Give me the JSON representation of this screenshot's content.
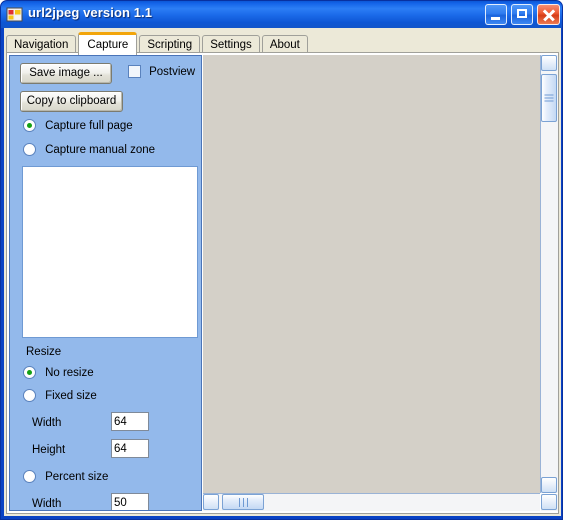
{
  "window": {
    "title": "url2jpeg version 1.1",
    "icon": "app-icon",
    "buttons": {
      "minimize": "minimize-icon",
      "maximize": "maximize-icon",
      "close": "close-icon"
    }
  },
  "tabs": [
    {
      "label": "Navigation",
      "selected": false
    },
    {
      "label": "Capture",
      "selected": true
    },
    {
      "label": "Scripting",
      "selected": false
    },
    {
      "label": "Settings",
      "selected": false
    },
    {
      "label": "About",
      "selected": false
    }
  ],
  "capture_panel": {
    "save_image_button": "Save image ...",
    "copy_clipboard_button": "Copy to clipboard",
    "postview": {
      "label": "Postview",
      "checked": false
    },
    "capture_mode": [
      {
        "label": "Capture full page",
        "selected": true
      },
      {
        "label": "Capture manual zone",
        "selected": false
      }
    ],
    "resize": {
      "group_label": "Resize",
      "options": [
        {
          "label": "No resize",
          "selected": true
        },
        {
          "label": "Fixed size",
          "selected": false
        },
        {
          "label": "Percent size",
          "selected": false
        }
      ],
      "fixed": {
        "width_label": "Width",
        "width_value": "64",
        "height_label": "Height",
        "height_value": "64"
      },
      "percent": {
        "width_label": "Width",
        "width_value": "50"
      }
    }
  },
  "scrollbars": {
    "vertical": {
      "up": "scroll-up-icon",
      "down": "scroll-down-icon"
    },
    "horizontal": {
      "left": "scroll-left-icon",
      "right": "scroll-right-icon"
    }
  },
  "colors": {
    "titlebar_blue": "#1363e8",
    "panel_blue": "#93b9eb",
    "viewport_gray": "#d4d0c8",
    "tab_accent_orange": "#f2a50a",
    "radio_dot_green": "#14a014",
    "close_button_red": "#ee5a33"
  }
}
